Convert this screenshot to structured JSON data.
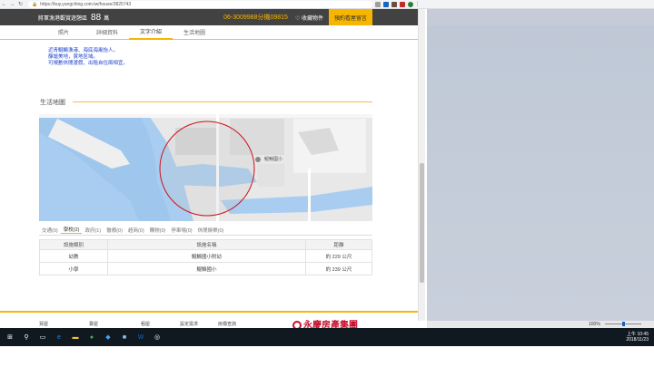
{
  "browser": {
    "url": "https://buy.yungching.com.tw/house/3825743"
  },
  "header": {
    "title": "將軍漁港觀賞遊憩區",
    "price": "88",
    "unit": "萬",
    "phone": "06-3009988分機09815",
    "favorite_label": "♡ 收藏物件",
    "cta_label": "預約看屋留言"
  },
  "tabs": [
    {
      "label": "照片"
    },
    {
      "label": "詳細資料"
    },
    {
      "label": "文字介紹"
    },
    {
      "label": "生活地圖"
    }
  ],
  "description": [
    "近青鯤鯓漁港、海底海風怡人。",
    "靜謐美地，賞地區域。",
    "可規劃休閒渡假、出租自住兩相宜。"
  ],
  "section_title": "生活地圖",
  "map": {
    "poi_label": "鯤鯓國小"
  },
  "categories": [
    {
      "label": "交通(0)"
    },
    {
      "label": "學校(2)"
    },
    {
      "label": "政府(1)"
    },
    {
      "label": "醫療(0)"
    },
    {
      "label": "超商(0)"
    },
    {
      "label": "購物(0)"
    },
    {
      "label": "停車場(0)"
    },
    {
      "label": "休閒娛樂(0)"
    }
  ],
  "table": {
    "headers": [
      "設施類別",
      "設施名稱",
      "距離"
    ],
    "rows": [
      [
        "幼教",
        "鯤鯓國小附幼",
        "約 229 公尺"
      ],
      [
        "小學",
        "鯤鯓國小",
        "約 239 公尺"
      ]
    ]
  },
  "footer": {
    "links": [
      "買屋",
      "賣屋",
      "租屋",
      "設定需求",
      "房價查詢"
    ],
    "logo": "永慶房產集團"
  },
  "status_bar": {
    "zoom": "100%"
  },
  "taskbar": {
    "time": "上午 10:45",
    "date": "2018/11/23"
  },
  "colors": {
    "accent": "#f7b500",
    "header_bg": "#424242",
    "link": "#1a3cc8",
    "circle": "#d0101a"
  }
}
